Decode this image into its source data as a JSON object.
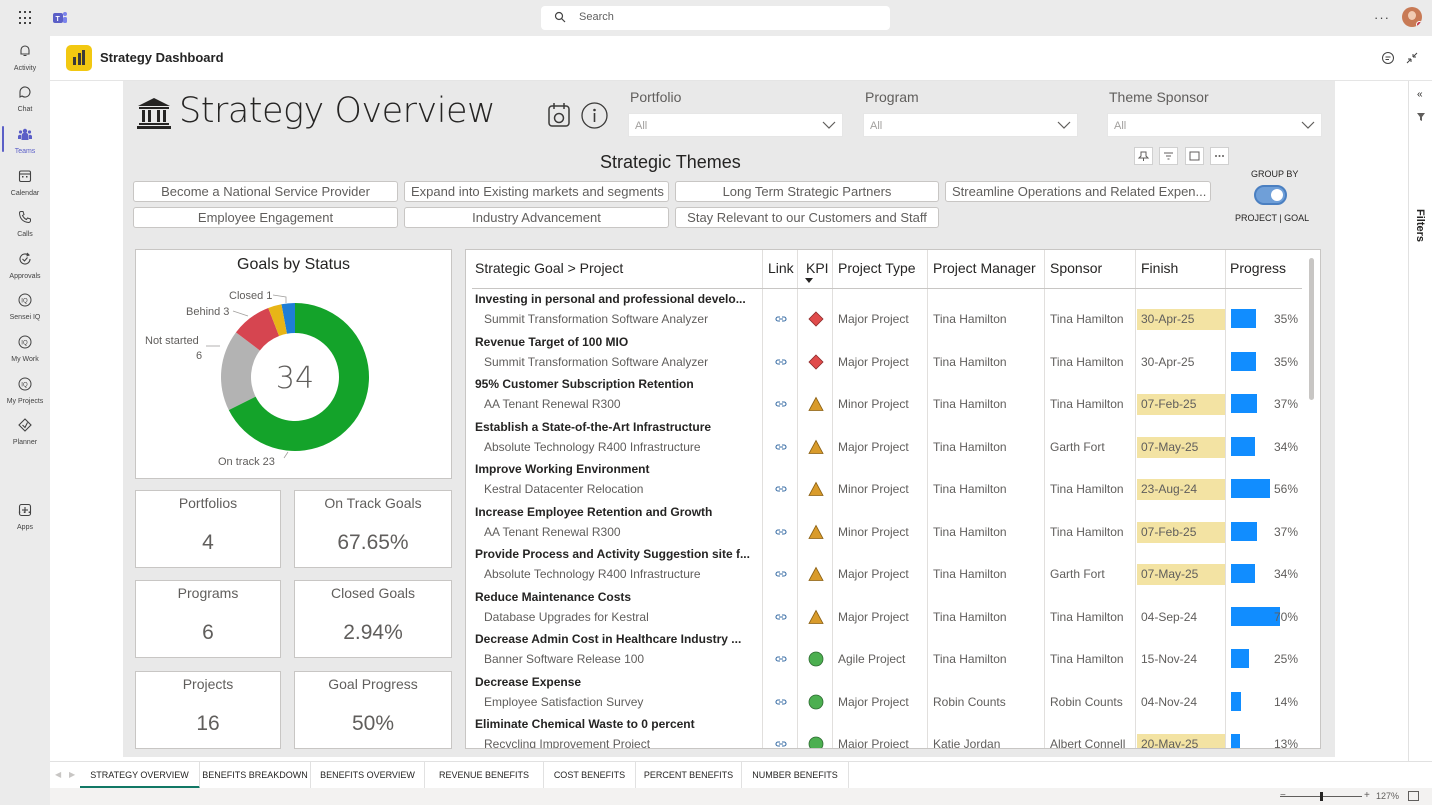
{
  "search": {
    "placeholder": "Search"
  },
  "rail": [
    {
      "label": "Activity",
      "icon": "bell-icon"
    },
    {
      "label": "Chat",
      "icon": "chat-icon"
    },
    {
      "label": "Teams",
      "icon": "teams-icon"
    },
    {
      "label": "Calendar",
      "icon": "calendar-icon"
    },
    {
      "label": "Calls",
      "icon": "phone-icon"
    },
    {
      "label": "Approvals",
      "icon": "approvals-icon"
    },
    {
      "label": "Sensei IQ",
      "icon": "iq-icon"
    },
    {
      "label": "My Work",
      "icon": "iq-icon"
    },
    {
      "label": "My Projects",
      "icon": "iq-icon"
    },
    {
      "label": "Planner",
      "icon": "planner-icon"
    },
    {
      "label": "Apps",
      "icon": "apps-icon"
    }
  ],
  "rail_more": "...",
  "app": {
    "title": "Strategy Dashboard"
  },
  "report": {
    "title": "Strategy Overview",
    "slicers": [
      {
        "label": "Portfolio",
        "value": "All"
      },
      {
        "label": "Program",
        "value": "All"
      },
      {
        "label": "Theme Sponsor",
        "value": "All"
      }
    ],
    "themes_title": "Strategic Themes",
    "themes": [
      "Become a National Service Provider",
      "Expand into Existing markets and segments",
      "Long Term Strategic Partners",
      "Streamline Operations and Related Expen...",
      "Employee Engagement",
      "Industry Advancement",
      "Stay Relevant to our Customers and Staff"
    ],
    "group_by": {
      "label": "GROUP BY",
      "state": "PROJECT | GOAL",
      "on": true
    },
    "filters_label": "Filters"
  },
  "chart_data": {
    "type": "pie",
    "title": "Goals by Status",
    "center_value": "34",
    "slices": [
      {
        "label": "On track",
        "value": 23,
        "color": "#14a32a"
      },
      {
        "label": "Not started",
        "value": 6,
        "color": "#b3b3b3"
      },
      {
        "label": "Behind",
        "value": 3,
        "color": "#d64550"
      },
      {
        "label": "Closed",
        "value": 1,
        "color": "#e8b516"
      },
      {
        "label": "",
        "value": 1,
        "color": "#1f7ed6"
      }
    ],
    "data_labels": [
      "On track 23",
      "Not started",
      "6",
      "Behind 3",
      "Closed 1"
    ]
  },
  "kpis": [
    {
      "label": "Portfolios",
      "value": "4"
    },
    {
      "label": "On Track Goals",
      "value": "67.65%"
    },
    {
      "label": "Programs",
      "value": "6"
    },
    {
      "label": "Closed Goals",
      "value": "2.94%"
    },
    {
      "label": "Projects",
      "value": "16"
    },
    {
      "label": "Goal Progress",
      "value": "50%"
    }
  ],
  "table": {
    "headers": [
      "Strategic Goal > Project",
      "Link",
      "KPI",
      "Project Type",
      "Project Manager",
      "Sponsor",
      "Finish",
      "Progress"
    ],
    "groups": [
      {
        "goal": "Investing in personal and professional develo...",
        "project": "Summit Transformation Software Analyzer",
        "kpi": "red-diamond",
        "type": "Major Project",
        "manager": "Tina Hamilton",
        "sponsor": "Tina Hamilton",
        "finish": "30-Apr-25",
        "highlight": true,
        "progress": 35,
        "progress_label": "35%"
      },
      {
        "goal": "Revenue Target of 100 MIO",
        "project": "Summit Transformation Software Analyzer",
        "kpi": "red-diamond",
        "type": "Major Project",
        "manager": "Tina Hamilton",
        "sponsor": "Tina Hamilton",
        "finish": "30-Apr-25",
        "highlight": false,
        "progress": 35,
        "progress_label": "35%"
      },
      {
        "goal": "95% Customer Subscription Retention",
        "project": "AA Tenant Renewal R300",
        "kpi": "yellow-triangle",
        "type": "Minor Project",
        "manager": "Tina Hamilton",
        "sponsor": "Tina Hamilton",
        "finish": "07-Feb-25",
        "highlight": true,
        "progress": 37,
        "progress_label": "37%"
      },
      {
        "goal": "Establish a State-of-the-Art Infrastructure",
        "project": "Absolute Technology R400 Infrastructure",
        "kpi": "yellow-triangle",
        "type": "Major Project",
        "manager": "Tina Hamilton",
        "sponsor": "Garth Fort",
        "finish": "07-May-25",
        "highlight": true,
        "progress": 34,
        "progress_label": "34%"
      },
      {
        "goal": "Improve Working Environment",
        "project": "Kestral Datacenter Relocation",
        "kpi": "yellow-triangle",
        "type": "Minor Project",
        "manager": "Tina Hamilton",
        "sponsor": "Tina Hamilton",
        "finish": "23-Aug-24",
        "highlight": true,
        "progress": 56,
        "progress_label": "56%"
      },
      {
        "goal": "Increase Employee Retention and Growth",
        "project": "AA Tenant Renewal R300",
        "kpi": "yellow-triangle",
        "type": "Minor Project",
        "manager": "Tina Hamilton",
        "sponsor": "Tina Hamilton",
        "finish": "07-Feb-25",
        "highlight": true,
        "progress": 37,
        "progress_label": "37%"
      },
      {
        "goal": "Provide Process and Activity Suggestion site f...",
        "project": "Absolute Technology R400 Infrastructure",
        "kpi": "yellow-triangle",
        "type": "Major Project",
        "manager": "Tina Hamilton",
        "sponsor": "Garth Fort",
        "finish": "07-May-25",
        "highlight": true,
        "progress": 34,
        "progress_label": "34%"
      },
      {
        "goal": "Reduce Maintenance Costs",
        "project": "Database Upgrades for Kestral",
        "kpi": "yellow-triangle",
        "type": "Major Project",
        "manager": "Tina Hamilton",
        "sponsor": "Tina Hamilton",
        "finish": "04-Sep-24",
        "highlight": false,
        "progress": 70,
        "progress_label": "70%"
      },
      {
        "goal": "Decrease Admin Cost in Healthcare Industry ...",
        "project": "Banner Software Release 100",
        "kpi": "green-circle",
        "type": "Agile Project",
        "manager": "Tina Hamilton",
        "sponsor": "Tina Hamilton",
        "finish": "15-Nov-24",
        "highlight": false,
        "progress": 25,
        "progress_label": "25%"
      },
      {
        "goal": "Decrease Expense",
        "project": "Employee Satisfaction Survey",
        "kpi": "green-circle",
        "type": "Major Project",
        "manager": "Robin Counts",
        "sponsor": "Robin Counts",
        "finish": "04-Nov-24",
        "highlight": false,
        "progress": 14,
        "progress_label": "14%"
      },
      {
        "goal": "Eliminate Chemical Waste to 0 percent",
        "project": "Recycling Improvement Project",
        "kpi": "green-circle",
        "type": "Major Project",
        "manager": "Katie Jordan",
        "sponsor": "Albert Connell",
        "finish": "20-May-25",
        "highlight": true,
        "progress": 13,
        "progress_label": "13%"
      }
    ]
  },
  "tabs": [
    "STRATEGY OVERVIEW",
    "BENEFITS BREAKDOWN",
    "BENEFITS OVERVIEW",
    "REVENUE BENEFITS",
    "COST BENEFITS",
    "PERCENT BENEFITS",
    "NUMBER BENEFITS"
  ],
  "active_tab": 0,
  "zoom": {
    "value": "127%",
    "minus": "−",
    "plus": "+"
  },
  "colors": {
    "accent": "#5b5fc7",
    "progress": "#118dff",
    "highlight": "#f3e3a3",
    "tab_active": "#117865"
  }
}
